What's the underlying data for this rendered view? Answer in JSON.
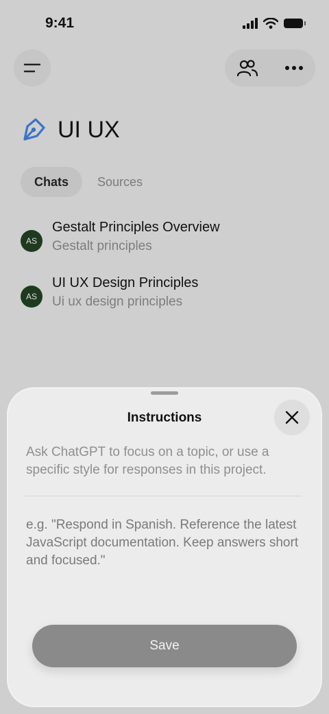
{
  "status_bar": {
    "time": "9:41",
    "icons": [
      "signal-icon",
      "wifi-icon",
      "battery-icon"
    ]
  },
  "header": {
    "menu_icon": "menu-icon",
    "people_icon": "people-icon",
    "more_icon": "more-horizontal-icon"
  },
  "project": {
    "title": "UI UX",
    "icon": "pen-tool-icon",
    "icon_color": "#3a73c9"
  },
  "tabs": [
    {
      "label": "Chats",
      "active": true
    },
    {
      "label": "Sources",
      "active": false
    }
  ],
  "chats": [
    {
      "avatar": "AS",
      "title": "Gestalt Principles Overview",
      "subtitle": "Gestalt principles"
    },
    {
      "avatar": "AS",
      "title": "UI UX Design Principles",
      "subtitle": "Ui ux design principles"
    }
  ],
  "sheet": {
    "title": "Instructions",
    "close_icon": "close-icon",
    "description": "Ask ChatGPT to focus on a topic, or use a specific style for responses in this project.",
    "input_placeholder": "e.g. \"Respond in Spanish. Reference the latest JavaScript documentation. Keep answers short and focused.\"",
    "input_value": "",
    "save_label": "Save"
  },
  "colors": {
    "avatar_bg": "#1e3a1f",
    "save_button": "#8a8a8a"
  }
}
